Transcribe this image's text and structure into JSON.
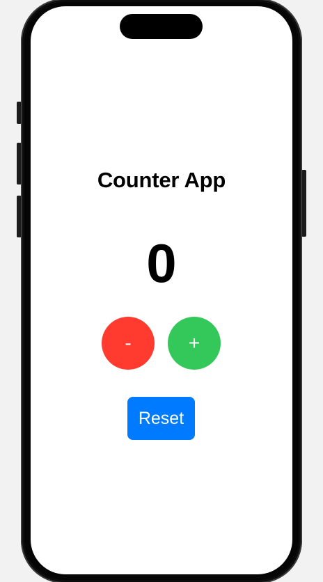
{
  "app": {
    "title": "Counter App",
    "count": "0"
  },
  "controls": {
    "decrement_label": "-",
    "increment_label": "+",
    "reset_label": "Reset"
  },
  "colors": {
    "decrement": "#ff3b30",
    "increment": "#34c759",
    "reset": "#007aff"
  }
}
